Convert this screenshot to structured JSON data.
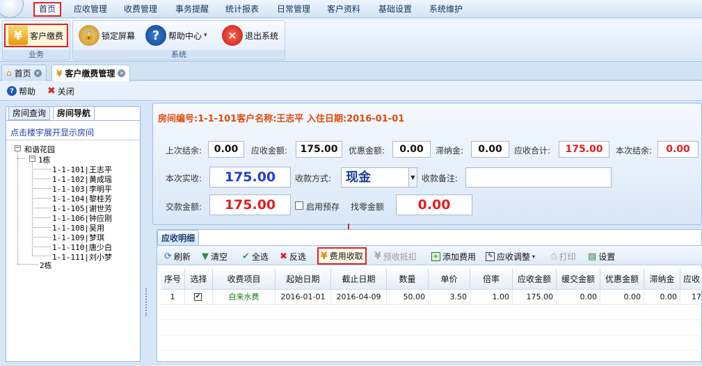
{
  "menu": [
    "首页",
    "应收管理",
    "收费管理",
    "事务提醒",
    "统计报表",
    "日常管理",
    "客户资料",
    "基础设置",
    "系统维护"
  ],
  "ribbon": {
    "groups": [
      "业务",
      "系统"
    ],
    "customer_pay": "客户缴费",
    "lock": "锁定屏幕",
    "help": "帮助中心",
    "exit": "退出系统"
  },
  "tabs": [
    "首页",
    "客户缴费管理"
  ],
  "toolbar": {
    "help": "帮助",
    "close": "关闭"
  },
  "left": {
    "tabs": [
      "房间查询",
      "房间导航"
    ],
    "hint": "点击楼宇展开显示房间",
    "root": "和谐花园",
    "building1": "1栋",
    "building2": "2栋",
    "rooms": [
      "1-1-101|王志平",
      "1-1-102|黄成瑶",
      "1-1-103|李明平",
      "1-1-104|黎桂芳",
      "1-1-105|谢世芳",
      "1-1-106|钟应刚",
      "1-1-108|吴用",
      "1-1-109|梦琪",
      "1-1-110|唐少白",
      "1-1-111|刘小梦"
    ]
  },
  "info": {
    "header": "房间编号:1-1-101客户名称:王志平 入住日期:2016-01-01",
    "labels": {
      "prev_balance": "上次结余:",
      "receivable": "应收金额:",
      "discount": "优惠金额:",
      "late_fee": "滞纳金:",
      "total": "应收合计:",
      "this_balance": "本次结余:",
      "actual": "本次实收:",
      "pay_method": "收款方式:",
      "remark": "收款备注:",
      "paid": "交款金额:",
      "use_prepay": "启用预存",
      "change": "找零金额"
    },
    "values": {
      "prev_balance": "0.00",
      "receivable": "175.00",
      "discount": "0.00",
      "late_fee": "0.00",
      "total": "175.00",
      "this_balance": "0.00",
      "actual": "175.00",
      "pay_method": "现金",
      "remark": "",
      "paid": "175.00",
      "change": "0.00"
    }
  },
  "grid": {
    "tab": "应收明细",
    "toolbar": [
      "刷新",
      "清空",
      "全选",
      "反选",
      "费用收取",
      "预收抵扣",
      "添加费用",
      "应收调整",
      "打印",
      "设置"
    ],
    "columns": [
      "序号",
      "选择",
      "收费项目",
      "起始日期",
      "截止日期",
      "数量",
      "单价",
      "倍率",
      "应收金额",
      "缓交金额",
      "优惠金额",
      "滞纳金",
      "应收"
    ],
    "row": {
      "no": "1",
      "item": "自来水费",
      "start": "2016-01-01",
      "end": "2016-04-09",
      "qty": "50.00",
      "price": "3.50",
      "rate": "1.00",
      "amount": "175.00",
      "defer": "0.00",
      "discount": "0.00",
      "late": "0.00",
      "recv": "17"
    }
  },
  "colors": {
    "accent_red": "#e02020",
    "value_blue": "#1d3fd1",
    "header_orange": "#e04a0c"
  }
}
